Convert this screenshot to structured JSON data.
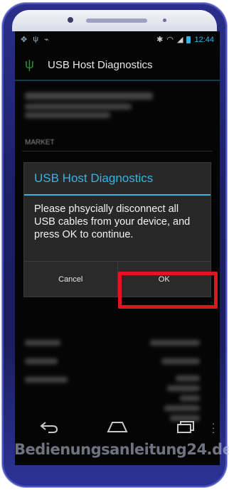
{
  "status_bar": {
    "time": "12:44"
  },
  "action_bar": {
    "title": "USB Host Diagnostics",
    "icon": "usb-icon"
  },
  "background": {
    "section_label": "MARKET"
  },
  "dialog": {
    "title": "USB Host Diagnostics",
    "message": "Please phsycially disconnect all USB cables from your device, and press OK to continue.",
    "cancel_label": "Cancel",
    "ok_label": "OK"
  },
  "nav_bar": {
    "back_icon": "back-icon",
    "home_icon": "home-icon",
    "recents_icon": "recents-icon",
    "menu_icon": "overflow-menu-icon"
  },
  "watermark": "Bedienungsanleitung24.de",
  "colors": {
    "accent": "#33b5e5",
    "highlight": "#e0161f",
    "dialog_bg": "#282828"
  }
}
